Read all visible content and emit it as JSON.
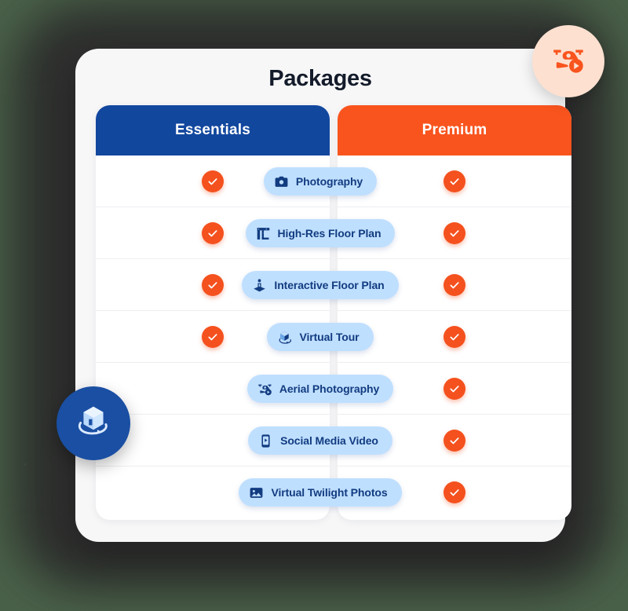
{
  "page": {
    "title": "Packages",
    "background_color": "#4a6149",
    "card_color": "#f7f7f8"
  },
  "columns": [
    {
      "name": "essentials",
      "label": "Essentials",
      "color": "#12479e"
    },
    {
      "name": "premium",
      "label": "Premium",
      "color": "#f9541e"
    }
  ],
  "check_color": "#f4511e",
  "pill": {
    "background": "#bfdfff",
    "text_color": "#123c80"
  },
  "features": [
    {
      "label": "Photography",
      "icon": "camera-icon",
      "essentials": true,
      "premium": true
    },
    {
      "label": "High-Res Floor Plan",
      "icon": "floor-plan-icon",
      "essentials": true,
      "premium": true
    },
    {
      "label": "Interactive Floor Plan",
      "icon": "interactive-pin-icon",
      "essentials": true,
      "premium": true
    },
    {
      "label": "Virtual Tour",
      "icon": "rotating-cube-icon",
      "essentials": true,
      "premium": true
    },
    {
      "label": "Aerial Photography",
      "icon": "drone-icon",
      "essentials": false,
      "premium": true
    },
    {
      "label": "Social Media Video",
      "icon": "phone-video-icon",
      "essentials": false,
      "premium": true
    },
    {
      "label": "Virtual Twilight Photos",
      "icon": "image-icon",
      "essentials": false,
      "premium": true
    }
  ],
  "badges": [
    {
      "name": "drone-video-badge",
      "icon": "drone-video-icon",
      "background": "#fde0d0",
      "icon_color": "#f9541e"
    },
    {
      "name": "virtual-tour-badge",
      "icon": "rotating-cube-icon",
      "background": "#1a4fa3",
      "icon_color": "#bfdfff"
    }
  ]
}
